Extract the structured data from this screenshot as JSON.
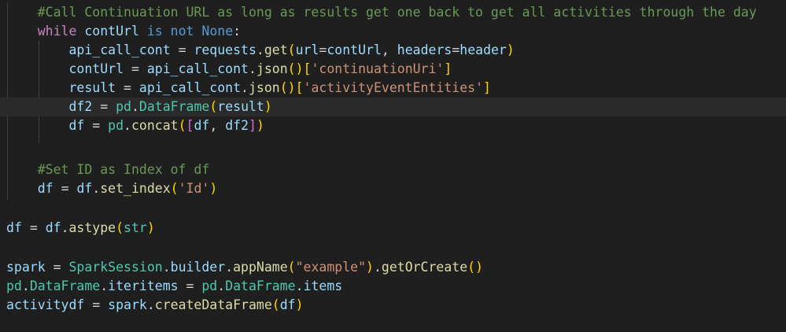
{
  "code": {
    "comment1": "#Call Continuation URL as long as results get one back to get all activities through the day",
    "while_kw": "while",
    "while_var": "contUrl",
    "is_not_kw": "is not",
    "none_kw": "None",
    "colon": ":",
    "api_var": "api_call_cont",
    "requests_mod": "requests",
    "get_fn": "get",
    "url_param": "url",
    "contUrl_arg": "contUrl",
    "headers_param": "headers",
    "header_arg": "header",
    "continuation_key": "'continuationUri'",
    "json_fn": "json",
    "result_var": "result",
    "entities_key": "'activityEventEntities'",
    "df2_var": "df2",
    "pd_mod": "pd",
    "dataframe_cls": "DataFrame",
    "df_var": "df",
    "concat_fn": "concat",
    "comment2": "#Set ID as Index of df",
    "set_index_fn": "set_index",
    "id_str": "'Id'",
    "astype_fn": "astype",
    "str_cls": "str",
    "spark_var": "spark",
    "sparksession_cls": "SparkSession",
    "builder_attr": "builder",
    "appname_fn": "appName",
    "example_str": "\"example\"",
    "getorcreate_fn": "getOrCreate",
    "iteritems_attr": "iteritems",
    "items_attr": "items",
    "activitydf_var": "activitydf",
    "createdf_fn": "createDataFrame"
  },
  "colors": {
    "background": "#1f1f1f",
    "keyword": "#c586c0",
    "constant": "#569cd6",
    "comment": "#6a9955",
    "variable": "#9cdcfe",
    "function": "#dcdcaa",
    "class": "#4ec9b0",
    "string": "#ce9178"
  }
}
